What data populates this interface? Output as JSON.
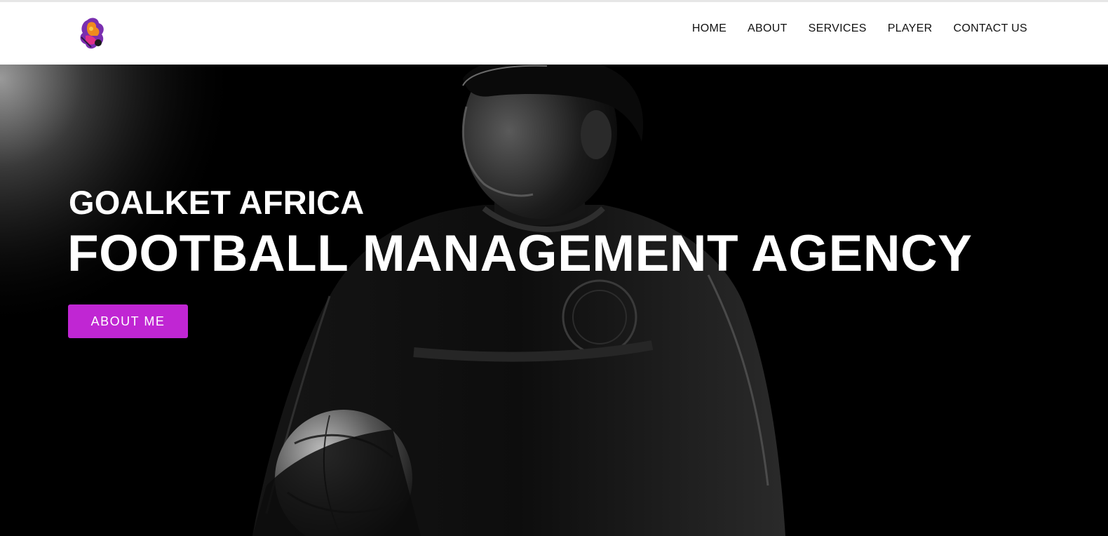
{
  "header": {
    "logo_icon": "goalket-logo-icon",
    "nav": [
      {
        "label": "HOME"
      },
      {
        "label": "ABOUT"
      },
      {
        "label": "SERVICES"
      },
      {
        "label": "PLAYER"
      },
      {
        "label": "CONTACT US"
      }
    ]
  },
  "hero": {
    "eyebrow": "GOALKET AFRICA",
    "headline": "FOOTBALL MANAGEMENT AGENCY",
    "cta_label": "ABOUT ME",
    "background": "black-and-white photo of young football player holding a ball"
  },
  "colors": {
    "accent": "#c026d3",
    "header_bg": "#ffffff",
    "hero_bg": "#000000",
    "nav_text": "#111111"
  }
}
